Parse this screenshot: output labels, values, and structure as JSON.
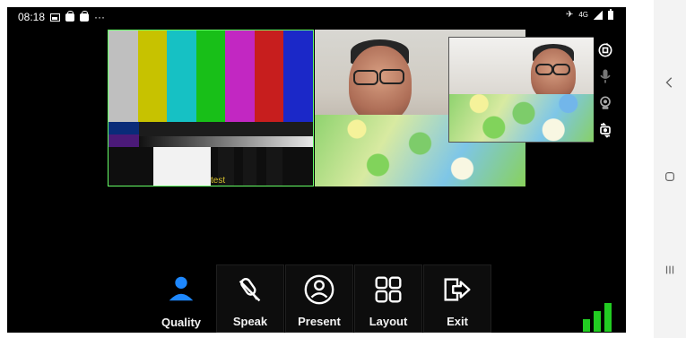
{
  "status_bar": {
    "time": "08:18",
    "left_icons": [
      "gallery-icon",
      "bag-icon",
      "bag-icon",
      "more-dots-icon"
    ],
    "right_icons": [
      "mute-icon",
      "network-icon",
      "signal-icon",
      "battery-icon"
    ],
    "network_label": "4G"
  },
  "videos": {
    "pattern_label": "test",
    "camera_label": ""
  },
  "controls": {
    "side": [
      "rotate-icon",
      "microphone-icon",
      "camera-icon",
      "switch-camera-icon"
    ]
  },
  "toolbar": {
    "items": [
      {
        "label": "Quality",
        "icon": "person-icon"
      },
      {
        "label": "Speak",
        "icon": "microphone-slash-icon"
      },
      {
        "label": "Present",
        "icon": "presenter-icon"
      },
      {
        "label": "Layout",
        "icon": "grid-icon"
      },
      {
        "label": "Exit",
        "icon": "exit-icon"
      }
    ]
  },
  "signal": {
    "level": 3,
    "max": 3,
    "color": "#22cc22"
  },
  "theme": {
    "background": "#000000",
    "accent": "#1e88ff",
    "text": "#ffffff"
  }
}
